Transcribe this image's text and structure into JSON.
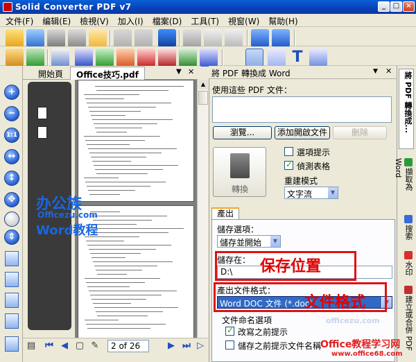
{
  "window": {
    "title": "Solid Converter PDF v7"
  },
  "menu": [
    "文件(F)",
    "编辑(E)",
    "檢視(V)",
    "加入(I)",
    "檔案(D)",
    "工具(T)",
    "視窗(W)",
    "幫助(H)"
  ],
  "tabs": {
    "start": "開始頁",
    "doc": "Office技巧.pdf"
  },
  "nav": {
    "page": "2 of 26"
  },
  "panel": {
    "title": "將 PDF 轉換成 Word",
    "use_label": "使用這些 PDF 文件：",
    "browse": "瀏覽...",
    "add_open": "添加開啟文件",
    "remove": "刪除",
    "convert": "轉換",
    "opt_hint": "選項提示",
    "opt_detect": "偵測表格",
    "rebuild_label": "重建模式",
    "rebuild_value": "文字流",
    "output_tab": "產出",
    "save_opts_label": "儲存選項：",
    "save_opts_value": "儲存並開始",
    "save_in_label": "儲存在：",
    "save_in_value": "D:\\",
    "format_label": "產出文件格式：",
    "format_value": "Word DOC 文件 (*.doc)",
    "naming_label": "文件命名選項",
    "naming_1": "改寫之前提示",
    "naming_2": "儲存之前提示文件名稱"
  },
  "side_tabs": [
    "將 PDF 轉換成...",
    "擷取為 Word",
    "搜索",
    "水印",
    "建立或合併 PDF"
  ],
  "annotations": {
    "save_location": "保存位置",
    "file_format": "文件格式"
  },
  "watermark": {
    "brand": "办公族",
    "domain": "Officezu.com",
    "course": "Word教程",
    "bottom": "Office教程学习网",
    "bottom_url": "www.office68.com",
    "mid": "officezu.com"
  }
}
